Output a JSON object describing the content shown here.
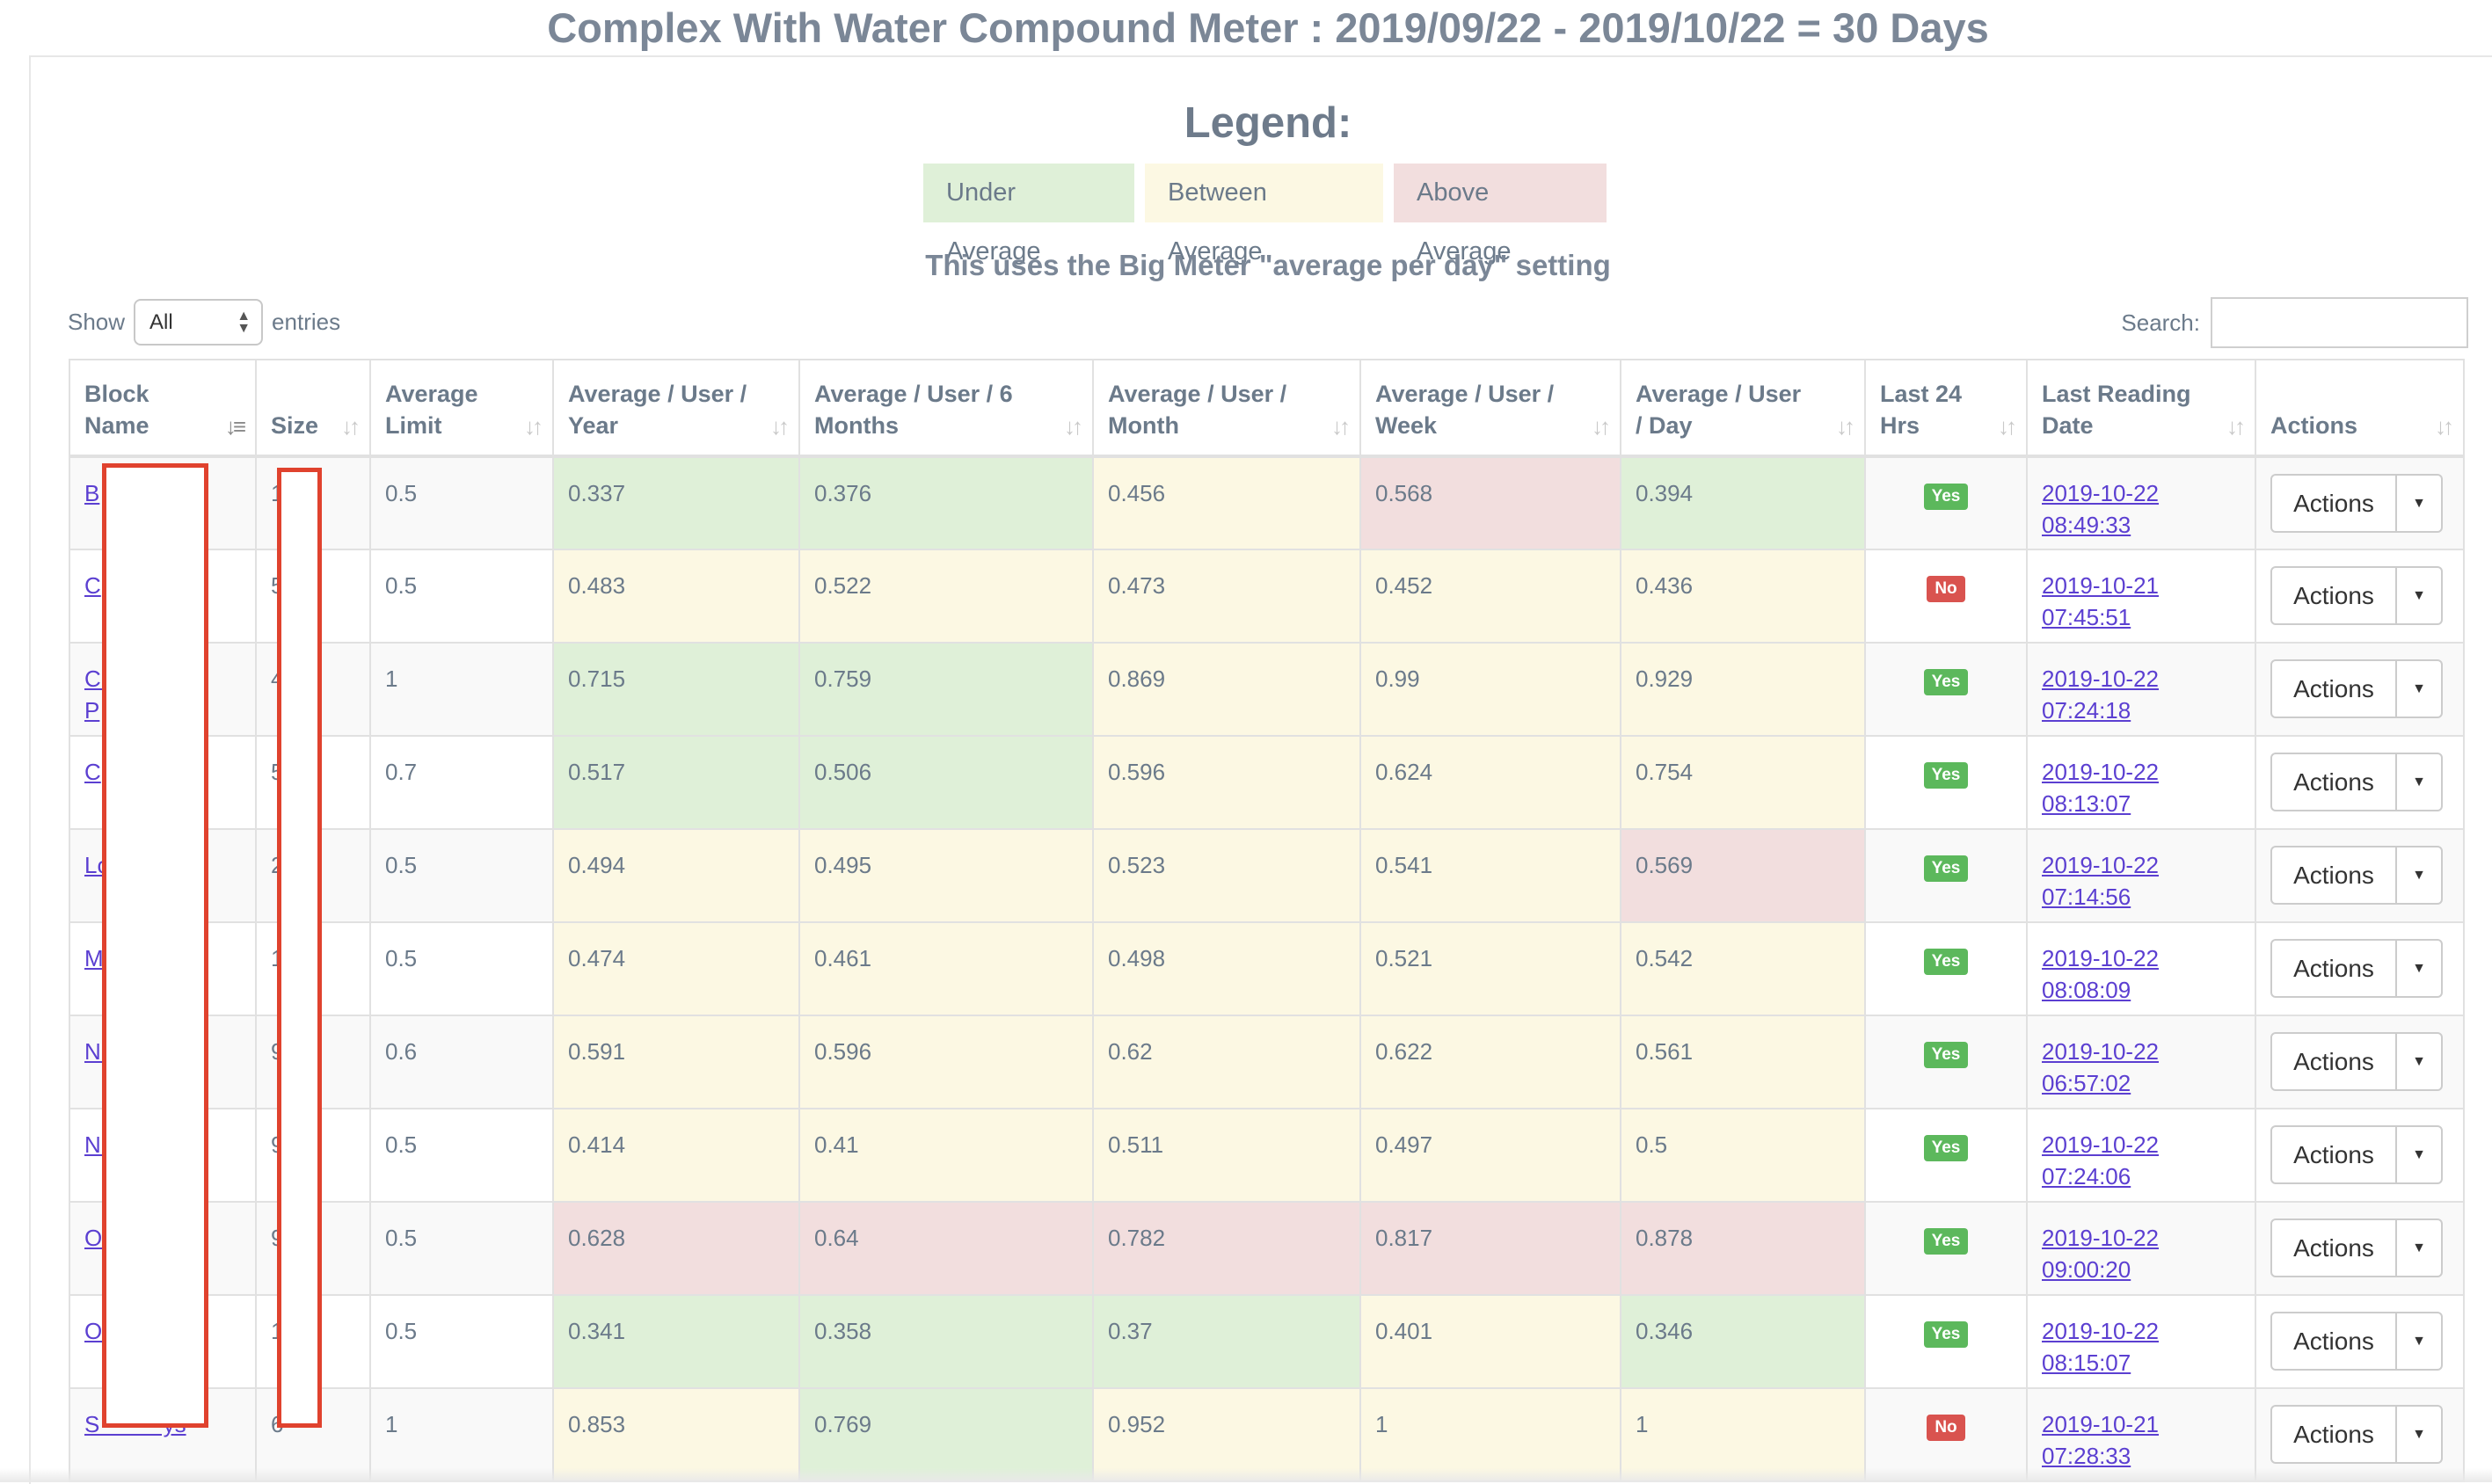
{
  "title": "Complex With Water Compound Meter : 2019/09/22 - 2019/10/22 = 30 Days",
  "legend": {
    "title": "Legend:",
    "items": [
      "Under Average",
      "Between Average",
      "Above Average"
    ],
    "note": "This uses the Big Meter \"average per day\" setting",
    "colors": {
      "under": "#dff0d8",
      "between": "#fcf8e3",
      "above": "#f2dede"
    }
  },
  "controls": {
    "show_label": "Show",
    "entries_value": "All",
    "entries_label": "entries",
    "search_label": "Search:",
    "search_value": ""
  },
  "table": {
    "headers": [
      {
        "l1": "Block",
        "l2": "Name",
        "sort": "↓≡"
      },
      {
        "l1": "",
        "l2": "Size",
        "sort": "↓↑"
      },
      {
        "l1": "Average",
        "l2": "Limit",
        "sort": "↓↑"
      },
      {
        "l1": "Average / User /",
        "l2": "Year",
        "sort": "↓↑"
      },
      {
        "l1": "Average / User / 6",
        "l2": "Months",
        "sort": "↓↑"
      },
      {
        "l1": "Average / User /",
        "l2": "Month",
        "sort": "↓↑"
      },
      {
        "l1": "Average / User /",
        "l2": "Week",
        "sort": "↓↑"
      },
      {
        "l1": "Average / User",
        "l2": "/ Day",
        "sort": "↓↑"
      },
      {
        "l1": "Last 24",
        "l2": "Hrs",
        "sort": "↓↑"
      },
      {
        "l1": "Last Reading",
        "l2": "Date",
        "sort": "↓↑"
      },
      {
        "l1": "",
        "l2": "Actions",
        "sort": "↓↑"
      }
    ],
    "rows": [
      {
        "name": "B",
        "name2": "",
        "size": "1",
        "limit": "0.5",
        "year": "0.337",
        "months6": "0.376",
        "month": "0.456",
        "week": "0.568",
        "day": "0.394",
        "last24": "Yes",
        "date1": "2019-10-22",
        "date2": "08:49:33",
        "action": "Actions",
        "cls": [
          "under",
          "under",
          "between",
          "above",
          "under"
        ]
      },
      {
        "name": "C",
        "name2": "",
        "size": "5",
        "limit": "0.5",
        "year": "0.483",
        "months6": "0.522",
        "month": "0.473",
        "week": "0.452",
        "day": "0.436",
        "last24": "No",
        "date1": "2019-10-21",
        "date2": "07:45:51",
        "action": "Actions",
        "cls": [
          "between",
          "between",
          "between",
          "between",
          "between"
        ]
      },
      {
        "name": "C          s",
        "name2": "P",
        "size": "4",
        "limit": "1",
        "year": "0.715",
        "months6": "0.759",
        "month": "0.869",
        "week": "0.99",
        "day": "0.929",
        "last24": "Yes",
        "date1": "2019-10-22",
        "date2": "07:24:18",
        "action": "Actions",
        "cls": [
          "under",
          "under",
          "between",
          "between",
          "between"
        ]
      },
      {
        "name": "C",
        "name2": "",
        "size": "5",
        "limit": "0.7",
        "year": "0.517",
        "months6": "0.506",
        "month": "0.596",
        "week": "0.624",
        "day": "0.754",
        "last24": "Yes",
        "date1": "2019-10-22",
        "date2": "08:13:07",
        "action": "Actions",
        "cls": [
          "under",
          "under",
          "between",
          "between",
          "between"
        ]
      },
      {
        "name": "Lo",
        "name2": "",
        "size": "2",
        "limit": "0.5",
        "year": "0.494",
        "months6": "0.495",
        "month": "0.523",
        "week": "0.541",
        "day": "0.569",
        "last24": "Yes",
        "date1": "2019-10-22",
        "date2": "07:14:56",
        "action": "Actions",
        "cls": [
          "between",
          "between",
          "between",
          "between",
          "above"
        ]
      },
      {
        "name": "M",
        "name2": "",
        "size": "1",
        "limit": "0.5",
        "year": "0.474",
        "months6": "0.461",
        "month": "0.498",
        "week": "0.521",
        "day": "0.542",
        "last24": "Yes",
        "date1": "2019-10-22",
        "date2": "08:08:09",
        "action": "Actions",
        "cls": [
          "between",
          "between",
          "between",
          "between",
          "between"
        ]
      },
      {
        "name": "N          t",
        "name2": "",
        "size": "9",
        "limit": "0.6",
        "year": "0.591",
        "months6": "0.596",
        "month": "0.62",
        "week": "0.622",
        "day": "0.561",
        "last24": "Yes",
        "date1": "2019-10-22",
        "date2": "06:57:02",
        "action": "Actions",
        "cls": [
          "between",
          "between",
          "between",
          "between",
          "between"
        ]
      },
      {
        "name": "N          e",
        "name2": "",
        "size": "9",
        "limit": "0.5",
        "year": "0.414",
        "months6": "0.41",
        "month": "0.511",
        "week": "0.497",
        "day": "0.5",
        "last24": "Yes",
        "date1": "2019-10-22",
        "date2": "07:24:06",
        "action": "Actions",
        "cls": [
          "between",
          "between",
          "between",
          "between",
          "between"
        ]
      },
      {
        "name": "O",
        "name2": "",
        "size": "9",
        "limit": "0.5",
        "year": "0.628",
        "months6": "0.64",
        "month": "0.782",
        "week": "0.817",
        "day": "0.878",
        "last24": "Yes",
        "date1": "2019-10-22",
        "date2": "09:00:20",
        "action": "Actions",
        "cls": [
          "above",
          "above",
          "above",
          "above",
          "above"
        ]
      },
      {
        "name": "O          e",
        "name2": "",
        "size": "1",
        "limit": "0.5",
        "year": "0.341",
        "months6": "0.358",
        "month": "0.37",
        "week": "0.401",
        "day": "0.346",
        "last24": "Yes",
        "date1": "2019-10-22",
        "date2": "08:15:07",
        "action": "Actions",
        "cls": [
          "under",
          "under",
          "under",
          "between",
          "under"
        ]
      },
      {
        "name": "S          ys",
        "name2": "",
        "size": "6",
        "limit": "1",
        "year": "0.853",
        "months6": "0.769",
        "month": "0.952",
        "week": "1",
        "day": "1",
        "last24": "No",
        "date1": "2019-10-21",
        "date2": "07:28:33",
        "action": "Actions",
        "cls": [
          "between",
          "under",
          "between",
          "between",
          "between"
        ]
      }
    ]
  }
}
